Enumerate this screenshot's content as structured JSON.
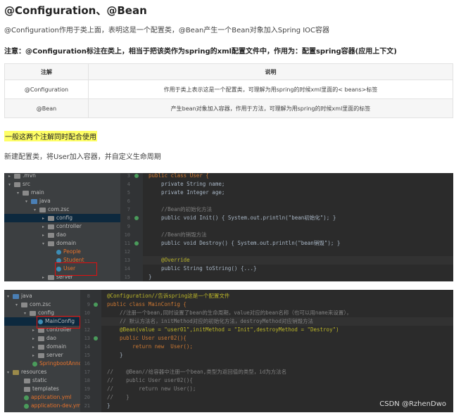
{
  "heading": "@Configuration、@Bean",
  "intro": "@Configuration作用于类上面，表明这是一个配置类，@Bean产生一个Bean对象加入Spring IOC容器",
  "note": "注意：@Configuration标注在类上，相当于把该类作为spring的xml配置文件中，作用为：配置spring容器(应用上下文)",
  "table": {
    "headers": [
      "注解",
      "说明"
    ],
    "rows": [
      [
        "@Configuration",
        "作用于类上表示这是一个配置类，可理解为用spring的时候xml里面的< beans>标签"
      ],
      [
        "@Bean",
        "产生bean对象加入容器，作用于方法，可理解为用spring的时候xml里面的标签"
      ]
    ]
  },
  "highlight": "一般这两个注解同时配合使用",
  "subtext": "新建配置类，将User加入容器，并自定义生命周期",
  "ide1": {
    "tree": [
      ".mvn",
      "src",
      "main",
      "java",
      "com.zsc",
      "config",
      "controller",
      "dao",
      "domain",
      "People",
      "Student",
      "User",
      "server"
    ],
    "line_numbers": [
      "3",
      "4",
      "5",
      "6",
      "7",
      "8",
      "9",
      "10",
      "11",
      "12",
      "13",
      "14",
      "15",
      "16",
      "17",
      "18",
      "19",
      "20"
    ],
    "lines": [
      "public class User {",
      "    private String name;",
      "    private Integer age;",
      "",
      "    //Bean的初始化方法",
      "    public void Init() { System.out.println(\"bean初始化\"); }",
      "",
      "    //Bean的销毁方法",
      "    public void Destroy() { System.out.println(\"bean销毁\"); }",
      "",
      "    @Override",
      "    public String toString() {...}",
      "}"
    ]
  },
  "ide2": {
    "tree": [
      "java",
      "com.zsc",
      "config",
      "MainConfig",
      "controller",
      "dao",
      "domain",
      "server",
      "SpringbootAnnotat",
      "resources",
      "static",
      "templates",
      "application.yml",
      "application-dev.yml"
    ],
    "line_numbers": [
      "8",
      "9",
      "10",
      "11",
      "12",
      "13",
      "14",
      "15",
      "16",
      "17",
      "18",
      "19",
      "20",
      "21",
      "22",
      "23"
    ],
    "lines": [
      "@Configuration//告诉spring这是一个配置文件",
      "public class MainConfig {",
      "    //注册一个bean,同时设置了bean的生命周期，value对应的bean名称（也可以用name来设置），",
      "    // 默认方法名，initMethod对应的初始化方法，destroyMethod对应销毁方法",
      "    @Bean(value = \"user01\",initMethod = \"Init\",destroyMethod = \"Destroy\")",
      "    public User user02(){",
      "        return new  User();",
      "    }",
      "",
      "//    @Bean//给容器中注册一个bean,类型为返回值的类型，id为方法名",
      "//    public User user02(){",
      "//        return new User();",
      "//    }",
      "}"
    ]
  },
  "watermark": "CSDN @RzhenDwo"
}
